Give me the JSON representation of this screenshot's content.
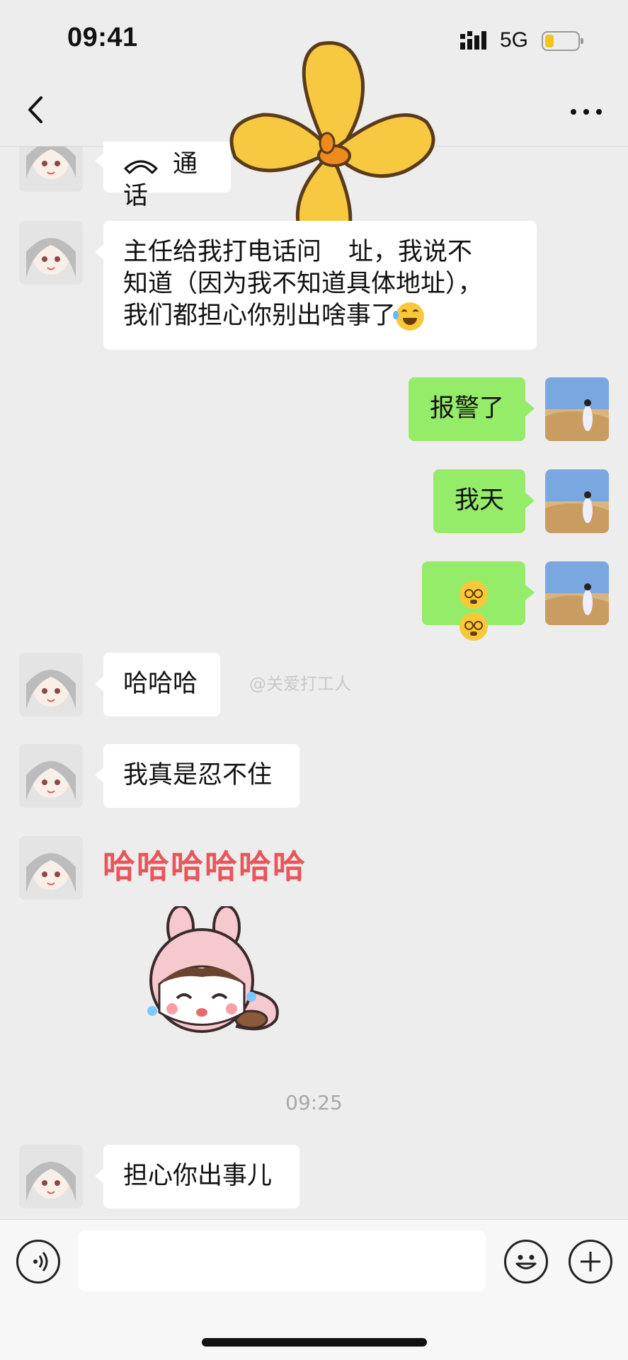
{
  "status_bar": {
    "time": "09:41",
    "network": "5G"
  },
  "messages": [
    {
      "side": "in",
      "text": "通话"
    },
    {
      "side": "in",
      "lines": [
        "主任给我打电话问",
        "址，我说不",
        "知道（因为我不知道具体地址），",
        "我们都担心你别出啥事了"
      ]
    },
    {
      "side": "out",
      "text": "报警了"
    },
    {
      "side": "out",
      "text": "我天"
    },
    {
      "side": "out",
      "emoji": "crying-face-icon x2"
    },
    {
      "side": "in",
      "text": "哈哈哈"
    },
    {
      "side": "in",
      "text": "我真是忍不住"
    },
    {
      "side": "in",
      "sticker_text": "哈哈哈哈哈哈",
      "sticker": "bunny-sticker"
    },
    {
      "timestamp": "09:25"
    },
    {
      "side": "in",
      "text": "担心你出事儿"
    }
  ],
  "watermark": "@关爱打工人",
  "colors": {
    "outgoing": "#95ec69",
    "incoming": "#ffffff",
    "background": "#ededed"
  }
}
